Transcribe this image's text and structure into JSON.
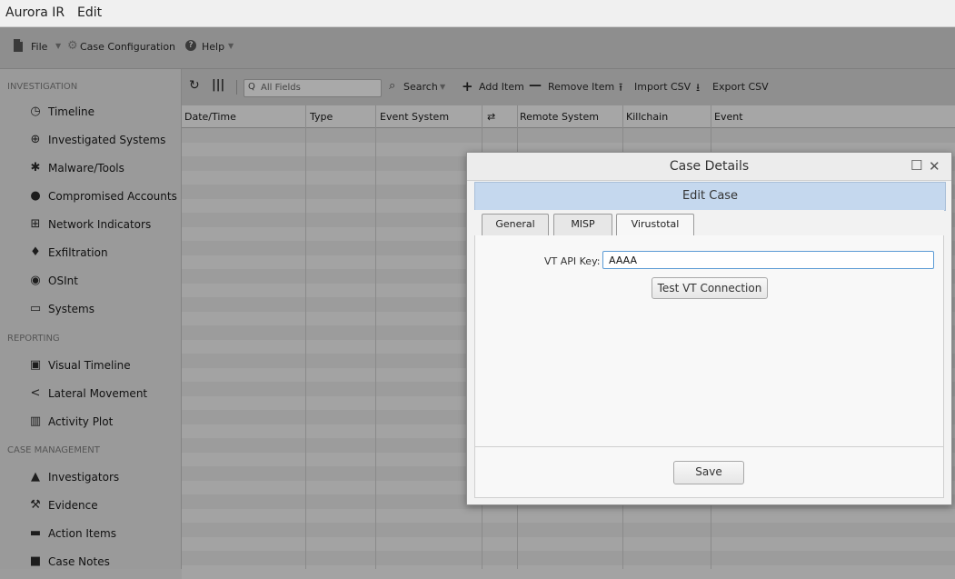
{
  "appbar": {
    "title": "Aurora IR",
    "edit": "Edit"
  },
  "menubar": {
    "file": "File",
    "case_config": "Case Configuration",
    "help": "Help"
  },
  "sidebar": {
    "sections": [
      "INVESTIGATION",
      "REPORTING",
      "CASE MANAGEMENT"
    ],
    "investigation": [
      {
        "label": "Timeline",
        "icon": "clock-icon"
      },
      {
        "label": "Investigated Systems",
        "icon": "magnifier-icon"
      },
      {
        "label": "Malware/Tools",
        "icon": "bug-icon"
      },
      {
        "label": "Compromised Accounts",
        "icon": "users-icon"
      },
      {
        "label": "Network Indicators",
        "icon": "network-icon"
      },
      {
        "label": "Exfiltration",
        "icon": "drop-icon"
      },
      {
        "label": "OSInt",
        "icon": "globe-icon"
      },
      {
        "label": "Systems",
        "icon": "monitor-icon"
      }
    ],
    "reporting": [
      {
        "label": "Visual Timeline",
        "icon": "calendar-icon"
      },
      {
        "label": "Lateral Movement",
        "icon": "share-icon"
      },
      {
        "label": "Activity Plot",
        "icon": "barchart-icon"
      }
    ],
    "case_management": [
      {
        "label": "Investigators",
        "icon": "user-icon"
      },
      {
        "label": "Evidence",
        "icon": "gavel-icon"
      },
      {
        "label": "Action Items",
        "icon": "briefcase-icon"
      },
      {
        "label": "Case Notes",
        "icon": "note-icon"
      }
    ]
  },
  "grid": {
    "search_placeholder": "All Fields",
    "toolbar": {
      "search": "Search",
      "add": "Add Item",
      "remove": "Remove Item",
      "import": "Import CSV",
      "export": "Export CSV"
    },
    "columns": [
      "Date/Time",
      "Type",
      "Event System",
      "⇄",
      "Remote System",
      "Killchain",
      "Event"
    ]
  },
  "dialog": {
    "title": "Case Details",
    "header": "Edit Case",
    "tabs": [
      "General",
      "MISP",
      "Virustotal"
    ],
    "vt_label": "VT API Key:",
    "vt_value": "AAAA",
    "test_button": "Test VT Connection",
    "save_button": "Save"
  }
}
